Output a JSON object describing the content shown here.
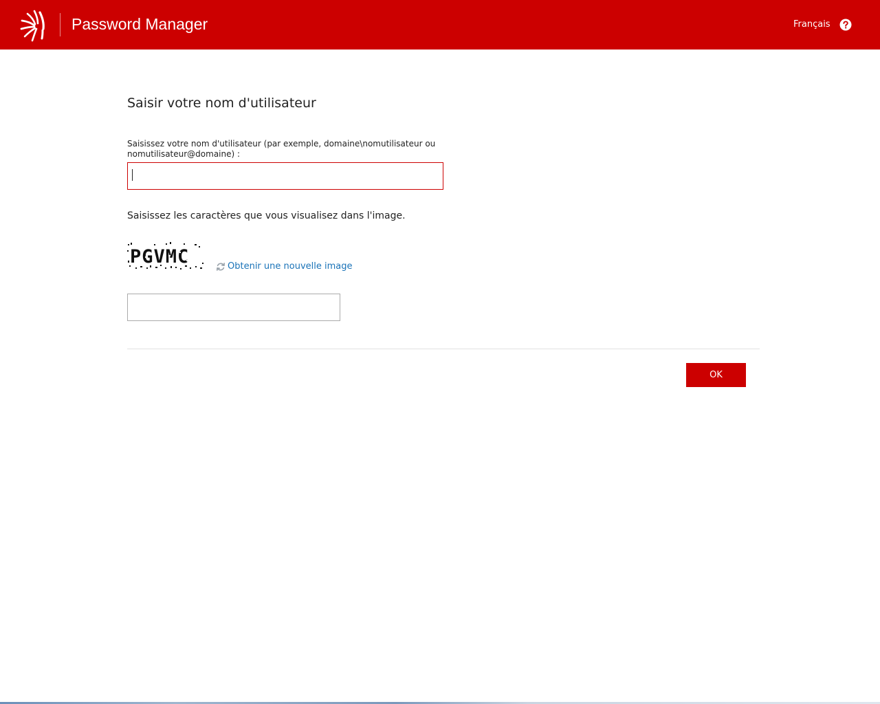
{
  "header": {
    "app_title": "Password Manager",
    "language_label": "Français",
    "help_icon": "question-circle-icon",
    "logo_icon": "sun-burst-logo"
  },
  "main": {
    "page_title": "Saisir votre nom d'utilisateur",
    "username_label": "Saisissez votre nom d'utilisateur (par exemple, domaine\\nomutilisateur ou nomutilisateur@domaine) :",
    "username_value": "",
    "captcha_instruction": "Saisissez les caractères que vous visualisez dans l'image.",
    "captcha_text": "PGVMC",
    "refresh_icon": "refresh-icon",
    "refresh_link": "Obtenir une nouvelle image",
    "captcha_value": ""
  },
  "footer": {
    "ok_label": "OK"
  },
  "colors": {
    "brand_red": "#cc0000",
    "link_blue": "#1a73b8"
  }
}
